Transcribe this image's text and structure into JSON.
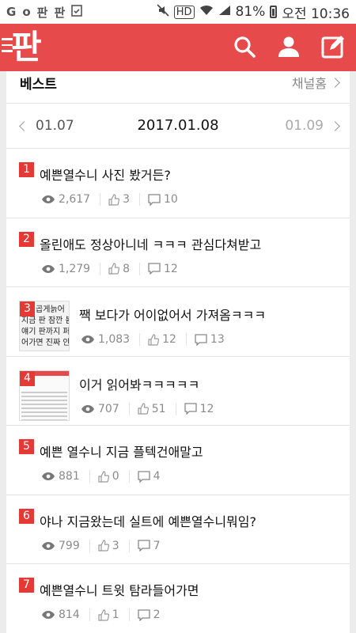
{
  "status_bar": {
    "left_icons": [
      "G",
      "o",
      "판",
      "판",
      "clipboard"
    ],
    "hd": "HD",
    "battery": "81%",
    "time": "오전 10:36"
  },
  "header": {
    "logo": "판",
    "icons": [
      "menu-icon",
      "search-icon",
      "user-icon",
      "write-icon"
    ],
    "accent_color": "#e64a4a"
  },
  "section": {
    "title": "베스트",
    "channel_link": "채널홈"
  },
  "date_nav": {
    "prev": "01.07",
    "current": "2017.01.08",
    "next": "01.09"
  },
  "posts": [
    {
      "rank": "1",
      "title": "예쁜열수니 사진 봤거든?",
      "views": "2,617",
      "likes": "3",
      "comments": "10",
      "thumb": null
    },
    {
      "rank": "2",
      "title": "올린애도 정상아니네 ㅋㅋㅋ 관심다쳐받고",
      "views": "1,279",
      "likes": "8",
      "comments": "12",
      "thumb": null
    },
    {
      "rank": "3",
      "title": "짹 보다가 어이없어서 가져옴ㅋㅋㅋ",
      "views": "1,083",
      "likes": "12",
      "comments": "13",
      "thumb": {
        "lines": [
          "곱게늙어",
          "지금 판 잠깐 봄",
          "얘기 판까지 퍼",
          "어가면 진짜 안"
        ]
      }
    },
    {
      "rank": "4",
      "title": "이거 읽어봐ㅋㅋㅋㅋㅋ",
      "views": "707",
      "likes": "51",
      "comments": "12",
      "thumb": {
        "lines": []
      }
    },
    {
      "rank": "5",
      "title": "예쁜 열수니 지금 플텍건애말고",
      "views": "881",
      "likes": "0",
      "comments": "4",
      "thumb": null
    },
    {
      "rank": "6",
      "title": "야나 지금왔는데 실트에 예쁜열수니뭐임?",
      "views": "799",
      "likes": "3",
      "comments": "7",
      "thumb": null
    },
    {
      "rank": "7",
      "title": "예쁜열수니 트윗 탐라들어가면",
      "views": "814",
      "likes": "1",
      "comments": "2",
      "thumb": null
    }
  ]
}
